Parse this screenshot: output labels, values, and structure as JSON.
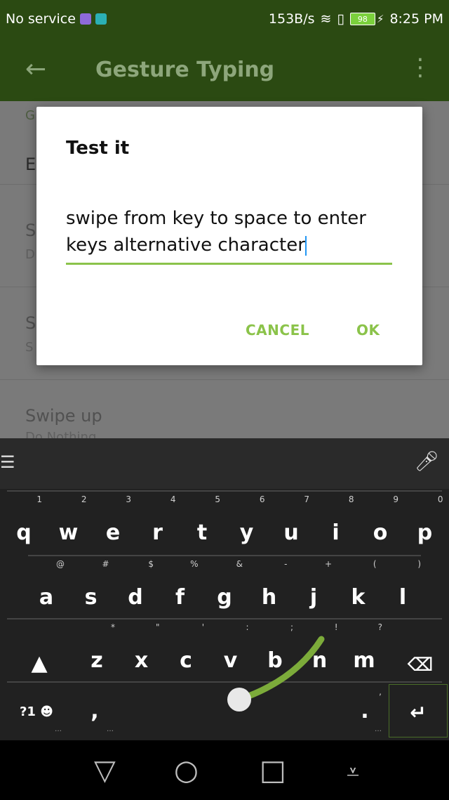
{
  "status": {
    "carrier": "No service",
    "speed": "153B/s",
    "battery": "98",
    "charge_icon": "⚡",
    "time": "8:25 PM"
  },
  "appbar": {
    "title": "Gesture Typing"
  },
  "list": {
    "section": "G",
    "item_e": "E",
    "row2_title": "S",
    "row2_sub": "D",
    "row3_title": "S",
    "row3_sub": "S",
    "row4_title": "Swipe up",
    "row4_sub": "Do Nothing"
  },
  "dialog": {
    "title": "Test it",
    "input_value": "swipe from key to space to enter keys alternative character",
    "cancel": "CANCEL",
    "ok": "OK"
  },
  "keyboard": {
    "row1": [
      {
        "key": "q",
        "hint": "1"
      },
      {
        "key": "w",
        "hint": "2"
      },
      {
        "key": "e",
        "hint": "3"
      },
      {
        "key": "r",
        "hint": "4"
      },
      {
        "key": "t",
        "hint": "5"
      },
      {
        "key": "y",
        "hint": "6"
      },
      {
        "key": "u",
        "hint": "7"
      },
      {
        "key": "i",
        "hint": "8"
      },
      {
        "key": "o",
        "hint": "9"
      },
      {
        "key": "p",
        "hint": "0"
      }
    ],
    "row2": [
      {
        "key": "a",
        "hint": "@"
      },
      {
        "key": "s",
        "hint": "#"
      },
      {
        "key": "d",
        "hint": "$"
      },
      {
        "key": "f",
        "hint": "%"
      },
      {
        "key": "g",
        "hint": "&"
      },
      {
        "key": "h",
        "hint": "-"
      },
      {
        "key": "j",
        "hint": "+"
      },
      {
        "key": "k",
        "hint": "("
      },
      {
        "key": "l",
        "hint": ")"
      }
    ],
    "row3": [
      {
        "key": "z",
        "hint": "*"
      },
      {
        "key": "x",
        "hint": "\""
      },
      {
        "key": "c",
        "hint": "'"
      },
      {
        "key": "v",
        "hint": ":"
      },
      {
        "key": "b",
        "hint": ";"
      },
      {
        "key": "n",
        "hint": "!"
      },
      {
        "key": "m",
        "hint": "?"
      }
    ],
    "symbols_label": "?1",
    "comma": ",",
    "period": ".",
    "period_hint": ","
  }
}
